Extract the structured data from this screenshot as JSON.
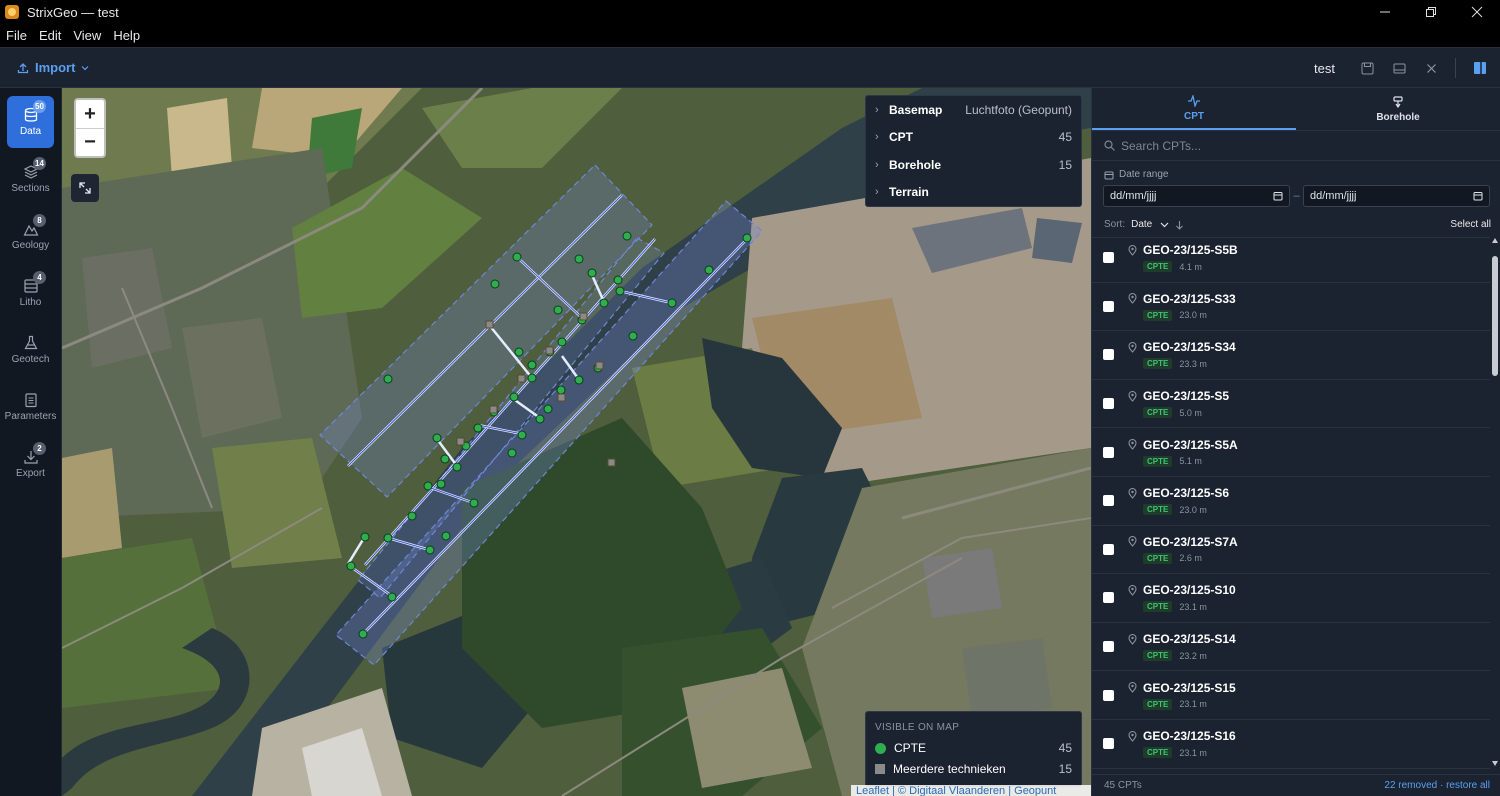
{
  "window": {
    "title": "StrixGeo — test"
  },
  "menu": [
    "File",
    "Edit",
    "View",
    "Help"
  ],
  "toolbar": {
    "import_label": "Import",
    "project_name": "test"
  },
  "sidebar": {
    "items": [
      {
        "label": "Data",
        "badge": "50"
      },
      {
        "label": "Sections",
        "badge": "14"
      },
      {
        "label": "Geology",
        "badge": "8"
      },
      {
        "label": "Litho",
        "badge": "4"
      },
      {
        "label": "Geotech",
        "badge": ""
      },
      {
        "label": "Parameters",
        "badge": ""
      },
      {
        "label": "Export",
        "badge": "2"
      }
    ]
  },
  "map": {
    "zoom_in": "+",
    "zoom_out": "−",
    "layers": [
      {
        "name": "Basemap",
        "value": "Luchtfoto (Geopunt)"
      },
      {
        "name": "CPT",
        "value": "45"
      },
      {
        "name": "Borehole",
        "value": "15"
      },
      {
        "name": "Terrain",
        "value": ""
      }
    ],
    "legend": {
      "title": "VISIBLE ON MAP",
      "items": [
        {
          "label": "CPTE",
          "count": "45",
          "color": "#2fae4f"
        },
        {
          "label": "Meerdere technieken",
          "count": "15",
          "color": "#8a8a8a"
        }
      ]
    },
    "attribution": "Leaflet | © Digitaal Vlaanderen | Geopunt"
  },
  "panel": {
    "tabs": [
      {
        "label": "CPT",
        "active": true
      },
      {
        "label": "Borehole",
        "active": false
      }
    ],
    "search_placeholder": "Search CPTs...",
    "date_range_label": "Date range",
    "date_from": "dd/mm/jjjj",
    "date_to": "dd/mm/jjjj",
    "date_sep": "–",
    "sort_label": "Sort:",
    "sort_value": "Date",
    "select_all": "Select all",
    "cpts": [
      {
        "name": "GEO-23/125-S5B",
        "type": "CPTE",
        "depth": "4.1 m"
      },
      {
        "name": "GEO-23/125-S33",
        "type": "CPTE",
        "depth": "23.0 m"
      },
      {
        "name": "GEO-23/125-S34",
        "type": "CPTE",
        "depth": "23.3 m"
      },
      {
        "name": "GEO-23/125-S5",
        "type": "CPTE",
        "depth": "5.0 m"
      },
      {
        "name": "GEO-23/125-S5A",
        "type": "CPTE",
        "depth": "5.1 m"
      },
      {
        "name": "GEO-23/125-S6",
        "type": "CPTE",
        "depth": "23.0 m"
      },
      {
        "name": "GEO-23/125-S7A",
        "type": "CPTE",
        "depth": "2.6 m"
      },
      {
        "name": "GEO-23/125-S10",
        "type": "CPTE",
        "depth": "23.1 m"
      },
      {
        "name": "GEO-23/125-S14",
        "type": "CPTE",
        "depth": "23.2 m"
      },
      {
        "name": "GEO-23/125-S15",
        "type": "CPTE",
        "depth": "23.1 m"
      },
      {
        "name": "GEO-23/125-S16",
        "type": "CPTE",
        "depth": "23.1 m"
      }
    ],
    "footer_count": "45 CPTs",
    "footer_restore": "22 removed · restore all"
  },
  "colors": {
    "accent": "#5aa0f0",
    "cpt_green": "#2fae4f",
    "borehole_gray": "#8a8a8a",
    "badge_green": "#3ec46d"
  }
}
